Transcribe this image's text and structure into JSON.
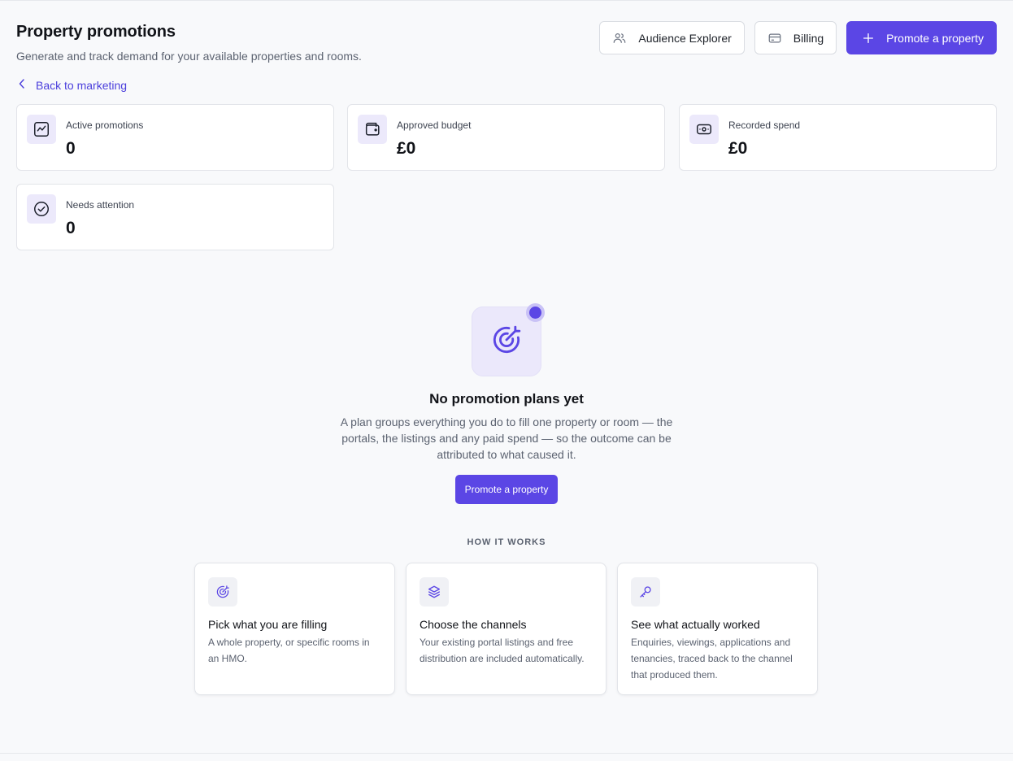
{
  "header": {
    "title": "Property promotions",
    "subtitle": "Generate and track demand for your available properties and rooms."
  },
  "actions": {
    "audience_label": "Audience Explorer",
    "billing_label": "Billing",
    "promote_label": "Promote a property"
  },
  "back_link": {
    "label": "Back to marketing"
  },
  "stats": [
    {
      "label": "Active promotions",
      "value": "0",
      "icon": "trend-icon"
    },
    {
      "label": "Approved budget",
      "value": "£0",
      "icon": "wallet-icon"
    },
    {
      "label": "Recorded spend",
      "value": "£0",
      "icon": "banknote-icon"
    },
    {
      "label": "Needs attention",
      "value": "0",
      "icon": "check-circle-icon"
    }
  ],
  "empty_state": {
    "icon": "target-icon",
    "title": "No promotion plans yet",
    "description": "A plan groups everything you do to fill one property or room — the portals, the listings and any paid spend — so the outcome can be attributed to what caused it.",
    "button_label": "Promote a property"
  },
  "how_it_works": {
    "heading": "HOW IT WORKS",
    "steps": [
      {
        "icon": "target-icon",
        "title": "Pick what you are filling",
        "description": "A whole property, or specific rooms in an HMO."
      },
      {
        "icon": "layers-icon",
        "title": "Choose the channels",
        "description": "Your existing portal listings and free distribution are included automatically."
      },
      {
        "icon": "key-icon",
        "title": "See what actually worked",
        "description": "Enquiries, viewings, applications and tenancies, traced back to the channel that produced them."
      }
    ]
  },
  "colors": {
    "accent": "#5b46e5",
    "accent_soft": "#ece9fb",
    "link": "#4b3fdc",
    "background": "#f8f9fb"
  }
}
